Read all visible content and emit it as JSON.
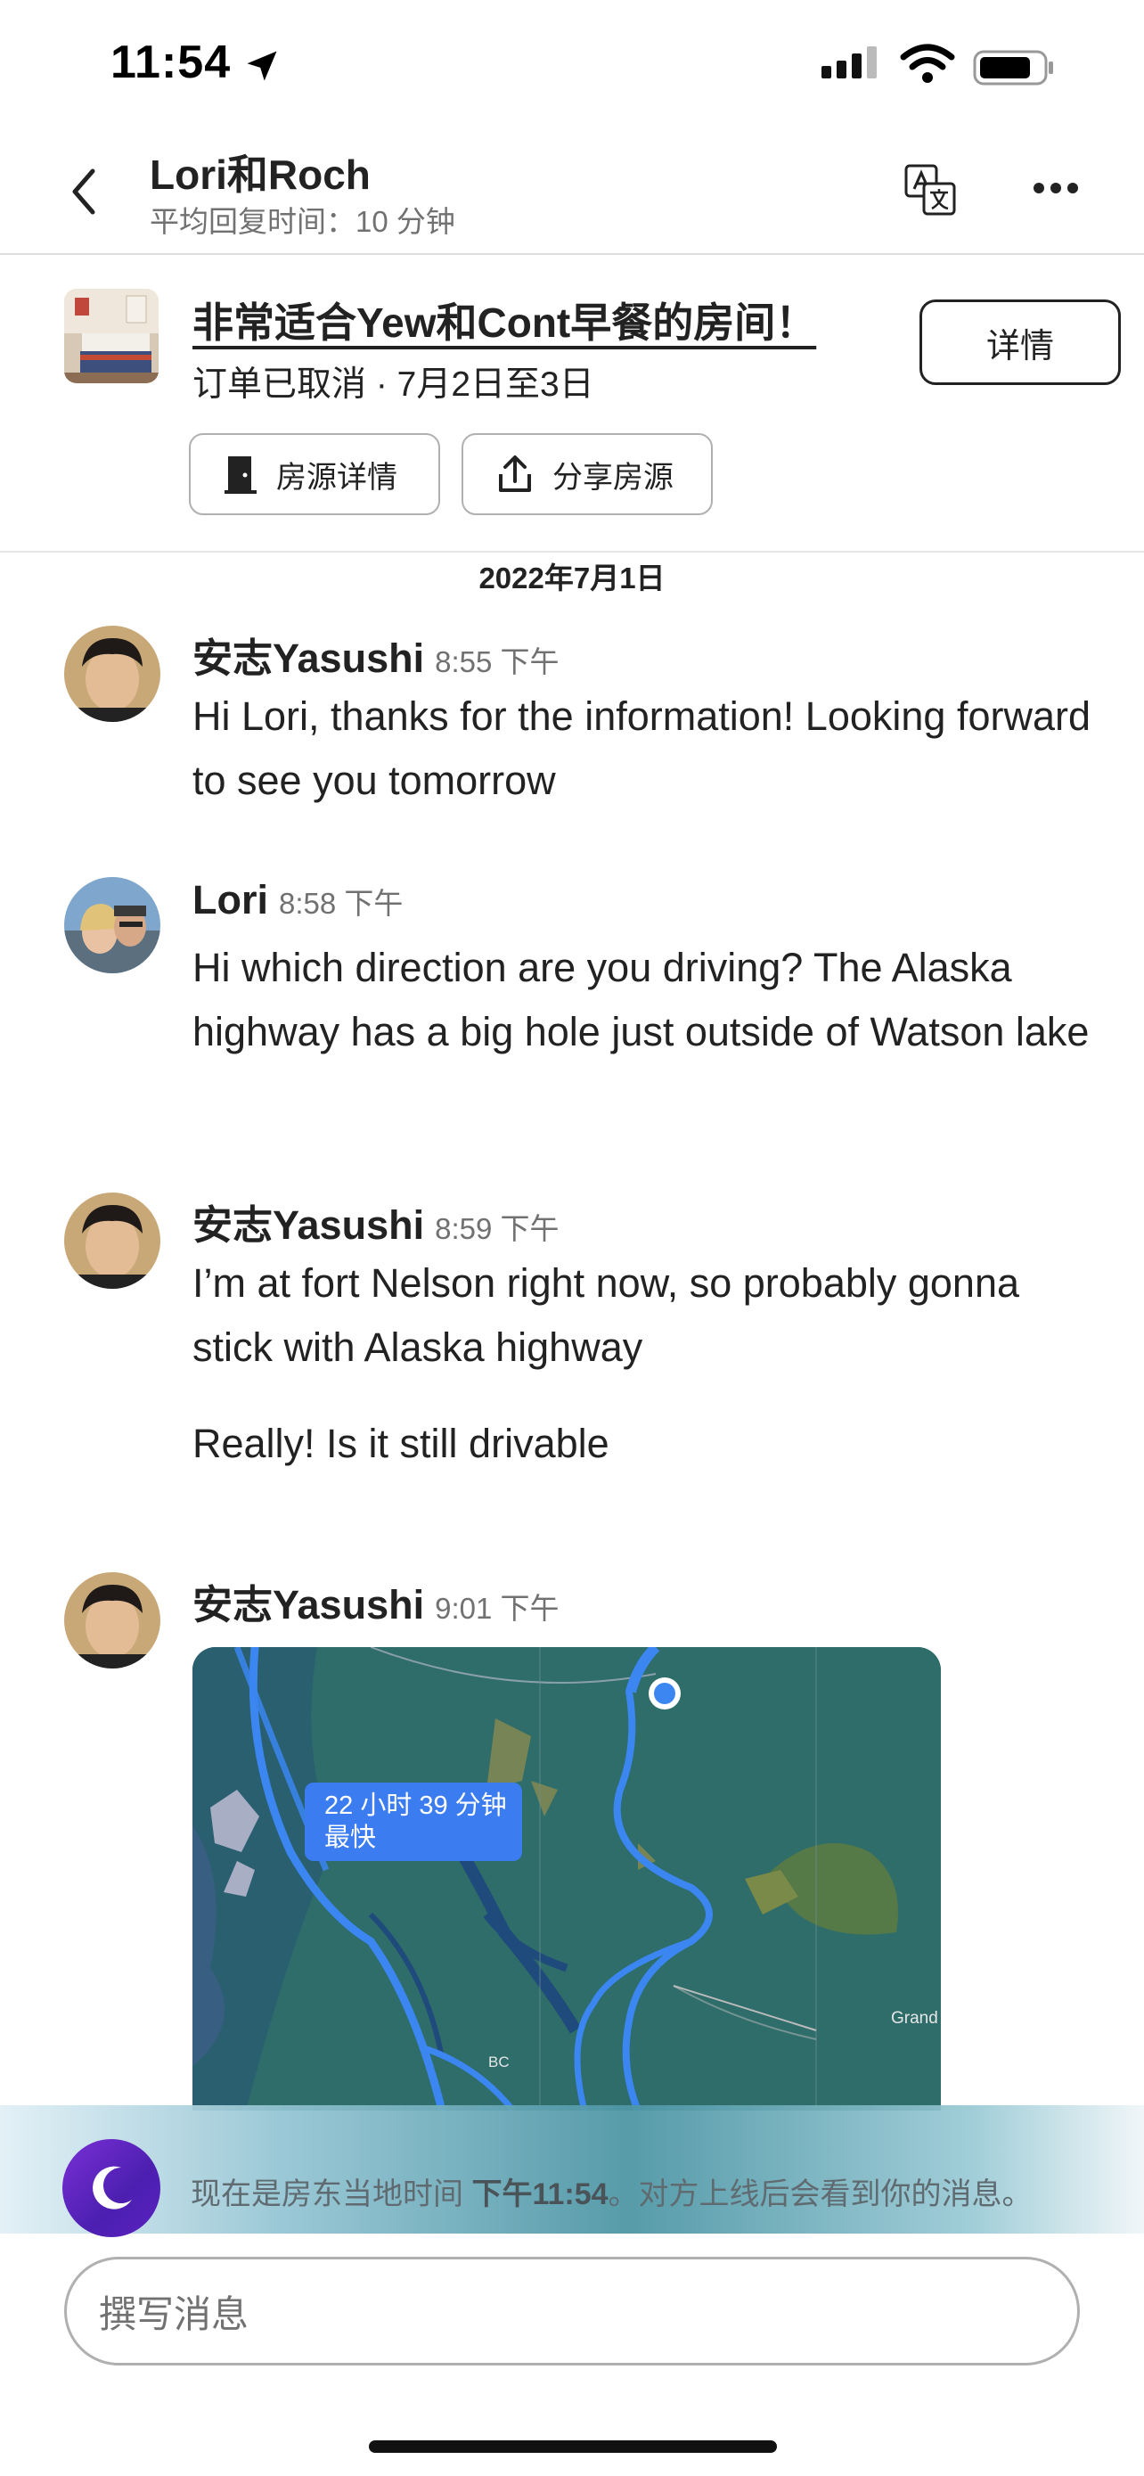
{
  "status_bar": {
    "time": "11:54"
  },
  "header": {
    "title": "Lori和Roch",
    "subtitle": "平均回复时间：10 分钟"
  },
  "listing": {
    "title": "非常适合Yew和Cont早餐的房间！",
    "status": "订单已取消 · 7月2日至3日",
    "details_button": "详情",
    "listing_details_button": "房源详情",
    "share_button": "分享房源"
  },
  "date_divider": "2022年7月1日",
  "messages": [
    {
      "sender": "安志Yasushi",
      "time": "8:55 下午",
      "text": "Hi Lori, thanks for the information! Looking forward to see you tomorrow"
    },
    {
      "sender": "Lori",
      "time": "8:58 下午",
      "text": "Hi which direction are you driving? The Alaska highway has a big hole just outside of Watson lake"
    },
    {
      "sender": "安志Yasushi",
      "time": "8:59 下午",
      "text": "I’m at fort Nelson right now, so probably gonna stick with Alaska highway",
      "text2": "Really! Is it still drivable"
    },
    {
      "sender": "安志Yasushi",
      "time": "9:01 下午",
      "map": {
        "route_time": "22 小时 39 分钟",
        "route_note": "最快",
        "label_bc": "BC",
        "label_grand": "Grand"
      }
    }
  ],
  "banner": {
    "prefix": "现在是房东当地时间 ",
    "time_bold": "下午11:54",
    "suffix": "。对方上线后会看到你的消息。"
  },
  "compose": {
    "placeholder": "撰写消息"
  },
  "colors": {
    "route_blue": "#3b7cf0",
    "moon_purple": "#6a28cc",
    "map_green": "#2f6f6c"
  }
}
